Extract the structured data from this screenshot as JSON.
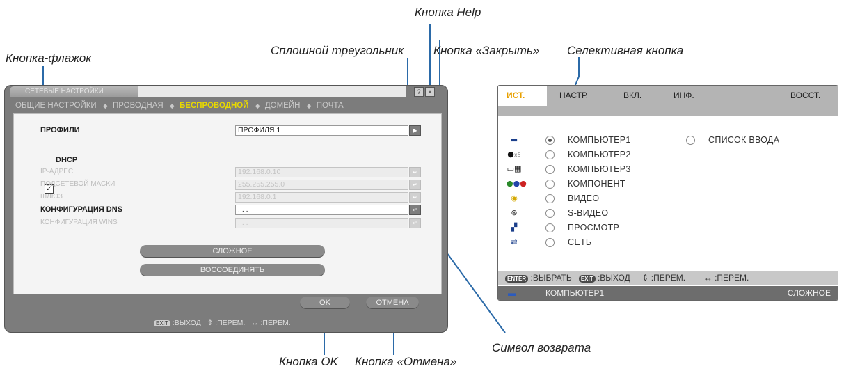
{
  "callouts": {
    "help": "Кнопка Help",
    "checkbox": "Кнопка-флажок",
    "triangle": "Сплошной треугольник",
    "close": "Кнопка «Закрыть»",
    "radio": "Селективная кнопка",
    "return_symbol": "Символ возврата",
    "ok": "Кнопка OK",
    "cancel": "Кнопка «Отмена»"
  },
  "dialog": {
    "title": "СЕТЕВЫЕ НАСТРОЙКИ",
    "help_label": "?",
    "close_label": "×",
    "tabs": [
      "ОБЩИЕ НАСТРОЙКИ",
      "ПРОВОДНАЯ",
      "БЕСПРОВОДНОЙ",
      "ДОМЕЙН",
      "ПОЧТА"
    ],
    "profiles_label": "ПРОФИЛИ",
    "profiles_value": "ПРОФИЛЯ 1",
    "dhcp_label": "DHCP",
    "dhcp_checked": true,
    "ip_label": "IP-АДРЕС",
    "ip_value": "192.168.0.10",
    "subnet_label": "ПОДСЕТЕВОЙ МАСКИ",
    "subnet_value": "255.255.255.0",
    "gateway_label": "ШЛЮЗ",
    "gateway_value": "192.168.0.1",
    "dns_label": "КОНФИГУРАЦИЯ DNS",
    "dns_value": ". . .",
    "auto_dns_label": "КОНФИГУРАЦИЯ WINS",
    "auto_dns_value": ". . .",
    "advanced_label": "СЛОЖНОЕ",
    "reconnect_label": "ВОССОЕДИНЯТЬ",
    "ok_label": "OK",
    "cancel_label": "ОТМЕНА",
    "footer_exit_key": "EXIT",
    "footer_exit": ":ВЫХОД",
    "footer_move1": "⇕ :ПЕРЕМ.",
    "footer_move2": "↔ :ПЕРЕМ."
  },
  "menu": {
    "tabs": [
      "ИСТ.",
      "НАСТР.",
      "ВКЛ.",
      "ИНФ.",
      "ВОССТ."
    ],
    "sources": [
      {
        "label": "КОМПЬЮТЕР1",
        "icon": "computer-icon",
        "selected": true
      },
      {
        "label": "КОМПЬЮТЕР2",
        "icon": "computer-5bnc-icon",
        "selected": false
      },
      {
        "label": "КОМПЬЮТЕР3",
        "icon": "dvi-icon",
        "selected": false
      },
      {
        "label": "КОМПОНЕНТ",
        "icon": "component-icon",
        "selected": false
      },
      {
        "label": "ВИДЕО",
        "icon": "video-icon",
        "selected": false
      },
      {
        "label": "S-ВИДЕО",
        "icon": "s-video-icon",
        "selected": false
      },
      {
        "label": "ПРОСМОТР",
        "icon": "viewer-icon",
        "selected": false
      },
      {
        "label": "СЕТЬ",
        "icon": "network-icon",
        "selected": false
      }
    ],
    "input_list_label": "СПИСОК ВВОДА",
    "help_enter_key": "ENTER",
    "help_select": ":ВЫБРАТЬ",
    "help_exit_key": "EXIT",
    "help_exit": ":ВЫХОД",
    "help_move_v": "⇕ :ПЕРЕМ.",
    "help_move_h": "↔ :ПЕРЕМ.",
    "status_source": "КОМПЬЮТЕР1",
    "status_right": "СЛОЖНОЕ"
  }
}
